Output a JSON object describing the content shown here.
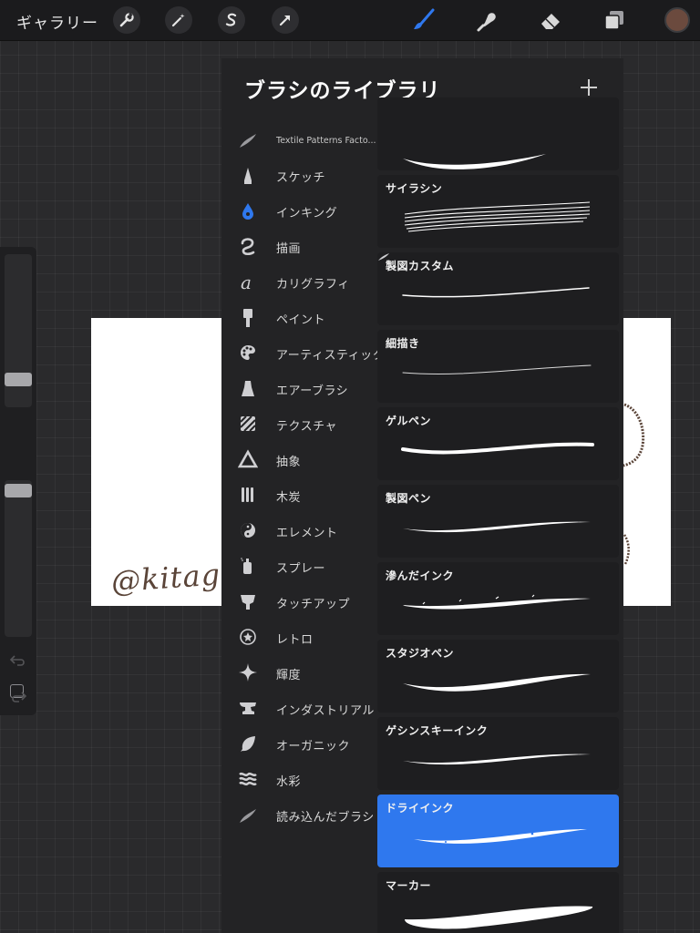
{
  "toolbar": {
    "gallery_label": "ギャラリー",
    "tools": [
      "actions",
      "adjustments",
      "selection",
      "transform"
    ],
    "paint_tools": [
      "brush",
      "smudge",
      "eraser",
      "layers"
    ],
    "active_tool": "brush",
    "accent_color": "#2f78ee",
    "current_color": "#6b4a3e"
  },
  "canvas": {
    "signature_text": "@kitagi"
  },
  "brush_library": {
    "title": "ブラシのライブラリ",
    "categories": [
      {
        "label": "Textile Patterns Facto...",
        "icon": "imported-brush-icon"
      },
      {
        "label": "スケッチ",
        "icon": "pencil-tip-icon"
      },
      {
        "label": "インキング",
        "icon": "ink-drop-icon",
        "active": true
      },
      {
        "label": "描画",
        "icon": "squiggle-icon"
      },
      {
        "label": "カリグラフィ",
        "icon": "calligraphy-a-icon"
      },
      {
        "label": "ペイント",
        "icon": "paint-brush-icon"
      },
      {
        "label": "アーティスティック",
        "icon": "palette-icon"
      },
      {
        "label": "エアーブラシ",
        "icon": "airbrush-icon"
      },
      {
        "label": "テクスチャ",
        "icon": "texture-icon"
      },
      {
        "label": "抽象",
        "icon": "triangle-icon"
      },
      {
        "label": "木炭",
        "icon": "charcoal-icon"
      },
      {
        "label": "エレメント",
        "icon": "yin-yang-icon"
      },
      {
        "label": "スプレー",
        "icon": "spray-can-icon"
      },
      {
        "label": "タッチアップ",
        "icon": "touch-up-icon"
      },
      {
        "label": "レトロ",
        "icon": "star-circle-icon"
      },
      {
        "label": "輝度",
        "icon": "sparkle-icon"
      },
      {
        "label": "インダストリアル",
        "icon": "anvil-icon"
      },
      {
        "label": "オーガニック",
        "icon": "leaf-icon"
      },
      {
        "label": "水彩",
        "icon": "waves-icon"
      },
      {
        "label": "読み込んだブラシ",
        "icon": "imported-brush-icon"
      }
    ],
    "brushes": [
      {
        "name": "",
        "stroke": "thick-taper"
      },
      {
        "name": "サイラシン",
        "stroke": "multi-line"
      },
      {
        "name": "製図カスタム",
        "stroke": "thin",
        "imported": true
      },
      {
        "name": "細描き",
        "stroke": "hairline"
      },
      {
        "name": "ゲルペン",
        "stroke": "round"
      },
      {
        "name": "製図ペン",
        "stroke": "thin-taper"
      },
      {
        "name": "滲んだインク",
        "stroke": "rough"
      },
      {
        "name": "スタジオペン",
        "stroke": "taper"
      },
      {
        "name": "ゲシンスキーインク",
        "stroke": "thin-taper"
      },
      {
        "name": "ドライインク",
        "stroke": "dry",
        "selected": true
      },
      {
        "name": "マーカー",
        "stroke": "marker"
      }
    ]
  }
}
